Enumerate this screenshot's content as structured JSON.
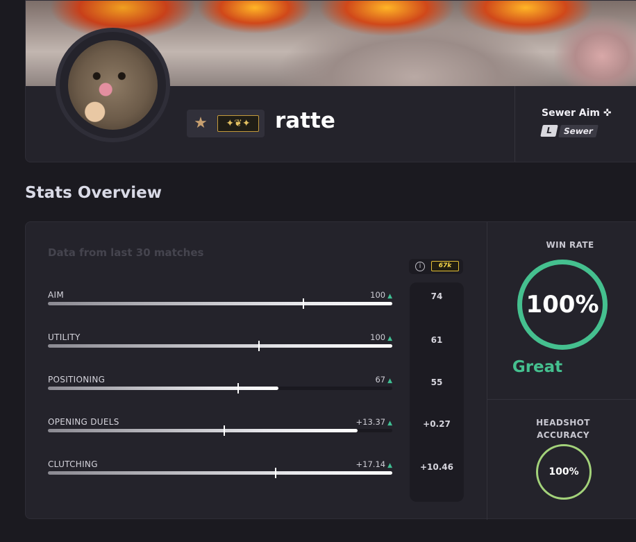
{
  "profile": {
    "username": "ratte",
    "rank_badge_icon": "eagle-rank-icon",
    "team": {
      "name": "Sewer Aim ✜",
      "tag": "Sewer"
    }
  },
  "stats": {
    "title": "Stats Overview",
    "note": "Data from last 30 matches",
    "elo_badge": "67k",
    "rows": [
      {
        "label": "AIM",
        "value": "100",
        "fill_pct": 100,
        "marker_pct": 74,
        "ref": "74"
      },
      {
        "label": "UTILITY",
        "value": "100",
        "fill_pct": 100,
        "marker_pct": 61,
        "ref": "61"
      },
      {
        "label": "POSITIONING",
        "value": "67",
        "fill_pct": 67,
        "marker_pct": 55,
        "ref": "55"
      },
      {
        "label": "OPENING DUELS",
        "value": "+13.37",
        "fill_pct": 90,
        "marker_pct": 51,
        "ref": "+0.27"
      },
      {
        "label": "CLUTCHING",
        "value": "+17.14",
        "fill_pct": 100,
        "marker_pct": 66,
        "ref": "+10.46"
      }
    ],
    "up_arrow": "▲"
  },
  "win_rate": {
    "title": "WIN RATE",
    "value": "100%",
    "rating": "Great",
    "color": "#45c08f"
  },
  "headshot": {
    "title_line1": "HEADSHOT",
    "title_line2": "ACCURACY",
    "value": "100%",
    "color": "#a3d27a"
  }
}
